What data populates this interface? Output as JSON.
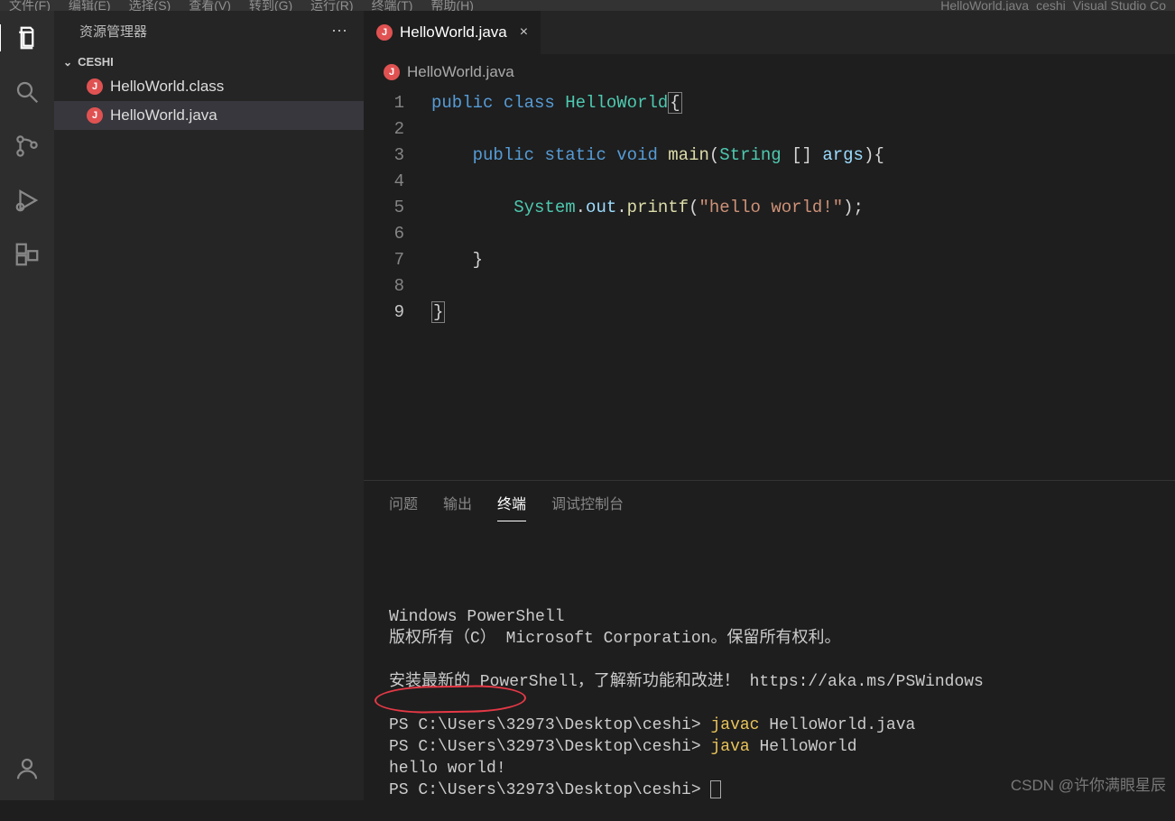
{
  "menubar": {
    "items": [
      "文件(F)",
      "编辑(E)",
      "选择(S)",
      "查看(V)",
      "转到(G)",
      "运行(R)",
      "终端(T)",
      "帮助(H)"
    ],
    "right": [
      "HelloWorld.java",
      "ceshi",
      "Visual Studio Co"
    ]
  },
  "sidebar": {
    "title": "资源管理器",
    "folder": "CESHI",
    "files": [
      {
        "name": "HelloWorld.class",
        "active": false
      },
      {
        "name": "HelloWorld.java",
        "active": true
      }
    ]
  },
  "tabs": [
    {
      "name": "HelloWorld.java"
    }
  ],
  "breadcrumb": "HelloWorld.java",
  "code": {
    "line_numbers": [
      "1",
      "2",
      "3",
      "4",
      "5",
      "6",
      "7",
      "8",
      "9"
    ],
    "lines": [
      [
        {
          "t": "public",
          "c": "kw"
        },
        {
          "t": " "
        },
        {
          "t": "class",
          "c": "kw"
        },
        {
          "t": " "
        },
        {
          "t": "HelloWorld",
          "c": "type"
        },
        {
          "t": "{",
          "c": "punc cursor-box"
        }
      ],
      [],
      [
        {
          "t": "    "
        },
        {
          "t": "public",
          "c": "kw"
        },
        {
          "t": " "
        },
        {
          "t": "static",
          "c": "kw"
        },
        {
          "t": " "
        },
        {
          "t": "void",
          "c": "kw"
        },
        {
          "t": " "
        },
        {
          "t": "main",
          "c": "func"
        },
        {
          "t": "(",
          "c": "punc"
        },
        {
          "t": "String",
          "c": "type"
        },
        {
          "t": " [] ",
          "c": "punc"
        },
        {
          "t": "args",
          "c": "var"
        },
        {
          "t": "){",
          "c": "punc"
        }
      ],
      [],
      [
        {
          "t": "        "
        },
        {
          "t": "System",
          "c": "type"
        },
        {
          "t": ".",
          "c": "punc"
        },
        {
          "t": "out",
          "c": "var"
        },
        {
          "t": ".",
          "c": "punc"
        },
        {
          "t": "printf",
          "c": "func"
        },
        {
          "t": "(",
          "c": "punc"
        },
        {
          "t": "\"hello world!\"",
          "c": "str"
        },
        {
          "t": ");",
          "c": "punc"
        }
      ],
      [],
      [
        {
          "t": "    }",
          "c": "punc"
        }
      ],
      [],
      [
        {
          "t": "}",
          "c": "punc cursor-box"
        }
      ]
    ]
  },
  "panel": {
    "tabs": [
      {
        "label": "问题",
        "active": false
      },
      {
        "label": "输出",
        "active": false
      },
      {
        "label": "终端",
        "active": true
      },
      {
        "label": "调试控制台",
        "active": false
      }
    ],
    "terminal_lines": [
      {
        "segments": [
          {
            "t": "Windows PowerShell"
          }
        ]
      },
      {
        "segments": [
          {
            "t": "版权所有（C） Microsoft Corporation。保留所有权利。"
          }
        ]
      },
      {
        "segments": [
          {
            "t": ""
          }
        ]
      },
      {
        "segments": [
          {
            "t": "安装最新的 PowerShell，了解新功能和改进！ https://aka.ms/PSWindows"
          }
        ]
      },
      {
        "segments": [
          {
            "t": ""
          }
        ]
      },
      {
        "segments": [
          {
            "t": "PS C:\\Users\\32973\\Desktop\\ceshi> "
          },
          {
            "t": "javac",
            "c": "yel"
          },
          {
            "t": " HelloWorld.java"
          }
        ]
      },
      {
        "segments": [
          {
            "t": "PS C:\\Users\\32973\\Desktop\\ceshi> "
          },
          {
            "t": "java",
            "c": "yel"
          },
          {
            "t": " HelloWorld"
          }
        ]
      },
      {
        "segments": [
          {
            "t": "hello world!"
          }
        ]
      },
      {
        "segments": [
          {
            "t": "PS C:\\Users\\32973\\Desktop\\ceshi> "
          }
        ],
        "cursor": true
      }
    ]
  },
  "watermark": "CSDN @许你满眼星辰"
}
